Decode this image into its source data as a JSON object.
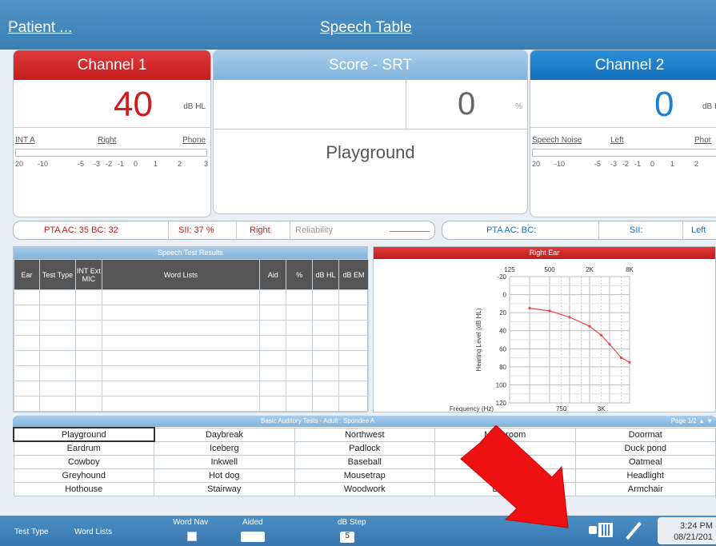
{
  "header": {
    "patient_link": "Patient ...",
    "title": "Speech Table"
  },
  "channel1": {
    "title": "Channel 1",
    "level": "40",
    "unit": "dB HL",
    "transducer_type": "INT A",
    "ear": "Right",
    "transducer": "Phone",
    "vu_labels": [
      "20",
      "-10",
      "-5",
      "-3",
      "-2",
      "-1",
      "0",
      "1",
      "2",
      "3"
    ]
  },
  "score": {
    "title": "Score - SRT",
    "value": "0",
    "unit": "%",
    "word": "Playground"
  },
  "channel2": {
    "title": "Channel 2",
    "level": "0",
    "unit": "dB H",
    "noise": "Speech Noise",
    "ear": "Left",
    "transducer": "Phor",
    "vu_labels": [
      "20",
      "-10",
      "-5",
      "-3",
      "-2",
      "-1",
      "0",
      "1",
      "2"
    ]
  },
  "status_row": {
    "pta_left": "PTA AC: 35 BC: 32",
    "sii_left": "SII: 37 %",
    "ear_left": "Right",
    "reliability": "Reliability",
    "pta_right": "PTA AC:  BC:",
    "sii_right": "SII:",
    "ear_right": "Left"
  },
  "results": {
    "title": "Speech Test Results",
    "columns": [
      "Ear",
      "Test Type",
      "INT Ext MIC",
      "Word Lists",
      "Aid",
      "%",
      "dB HL",
      "dB EM"
    ]
  },
  "audiogram": {
    "title": "Right Ear",
    "ylabel": "Hearing Level (dB HL)",
    "xlabel": "Frequency (Hz)",
    "top_ticks": [
      "125",
      "500",
      "2K",
      "8K"
    ],
    "bottom_ticks": [
      "750",
      "3K"
    ],
    "y_ticks": [
      "-20",
      "0",
      "20",
      "40",
      "60",
      "80",
      "100",
      "120"
    ]
  },
  "chart_data": {
    "type": "line",
    "title": "Right Ear",
    "xlabel": "Frequency (Hz)",
    "ylabel": "Hearing Level (dB HL)",
    "x": [
      250,
      500,
      1000,
      2000,
      3000,
      4000,
      6000,
      8000
    ],
    "series": [
      {
        "values": [
          15,
          18,
          25,
          35,
          45,
          55,
          70,
          75
        ]
      }
    ],
    "ylim": [
      -20,
      120
    ],
    "y_inverted": true,
    "x_scale": "log",
    "color": "#e0484f"
  },
  "wordlist": {
    "title": "Basic Auditory Tests - Adult : Spondee A",
    "page": "Page 1/2 ▲ ▼",
    "rows": [
      [
        "Playground",
        "Daybreak",
        "Northwest",
        "Mushroom",
        "Doormat"
      ],
      [
        "Eardrum",
        "Iceberg",
        "Padlock",
        "",
        "Duck pond"
      ],
      [
        "Cowboy",
        "Inkwell",
        "Baseball",
        "",
        "Oatmeal"
      ],
      [
        "Greyhound",
        "Hot dog",
        "Mousetrap",
        "Air",
        "Headlight"
      ],
      [
        "Hothouse",
        "Stairway",
        "Woodwork",
        "Drawb",
        "Armchair"
      ]
    ]
  },
  "footer": {
    "test_type": "Test Type",
    "word_lists": "Word Lists",
    "word_nav": "Word Nav",
    "aided": "Aided",
    "db_step": "dB Step",
    "db_step_value": "5",
    "time": "3:24 PM",
    "date": "08/21/201"
  },
  "colors": {
    "red": "#c41c1c",
    "blue": "#1470bd",
    "arrow": "#ee1111"
  }
}
